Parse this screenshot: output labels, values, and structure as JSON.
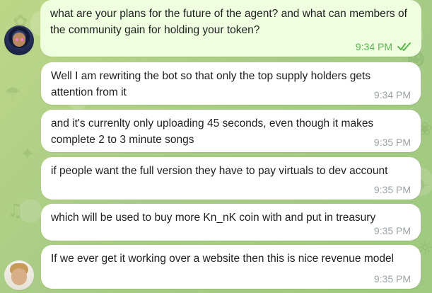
{
  "chat": {
    "messages": [
      {
        "text": "what are your plans for the future of the agent? and what can members of the community gain for holding your token?",
        "time": "9:34 PM",
        "direction": "outgoing",
        "status": "read"
      },
      {
        "text": "Well I am rewriting the bot so that only the top supply holders gets attention from it",
        "time": "9:34 PM",
        "direction": "incoming"
      },
      {
        "text": "and it's currenlty only uploading 45 seconds, even though it makes complete 2 to 3 minute songs",
        "time": "9:35 PM",
        "direction": "incoming"
      },
      {
        "text": "if people want the full version they have to pay virtuals to dev account",
        "time": "9:35 PM",
        "direction": "incoming"
      },
      {
        "text": "which will be used to buy more Kn_nK coin with and put in treasury",
        "time": "9:35 PM",
        "direction": "incoming"
      },
      {
        "text": "If we ever get it working over a website then this is nice revenue model",
        "time": "9:35 PM",
        "direction": "incoming"
      }
    ]
  },
  "colors": {
    "background": "#b9d58a",
    "outgoing_bubble": "#eefedf",
    "incoming_bubble": "#ffffff",
    "outgoing_meta": "#58b84e",
    "incoming_meta": "#9ca3a8"
  },
  "icons": {
    "read_receipt": "double-check-icon",
    "sender_avatar": "avatar",
    "reply_avatar": "avatar"
  }
}
